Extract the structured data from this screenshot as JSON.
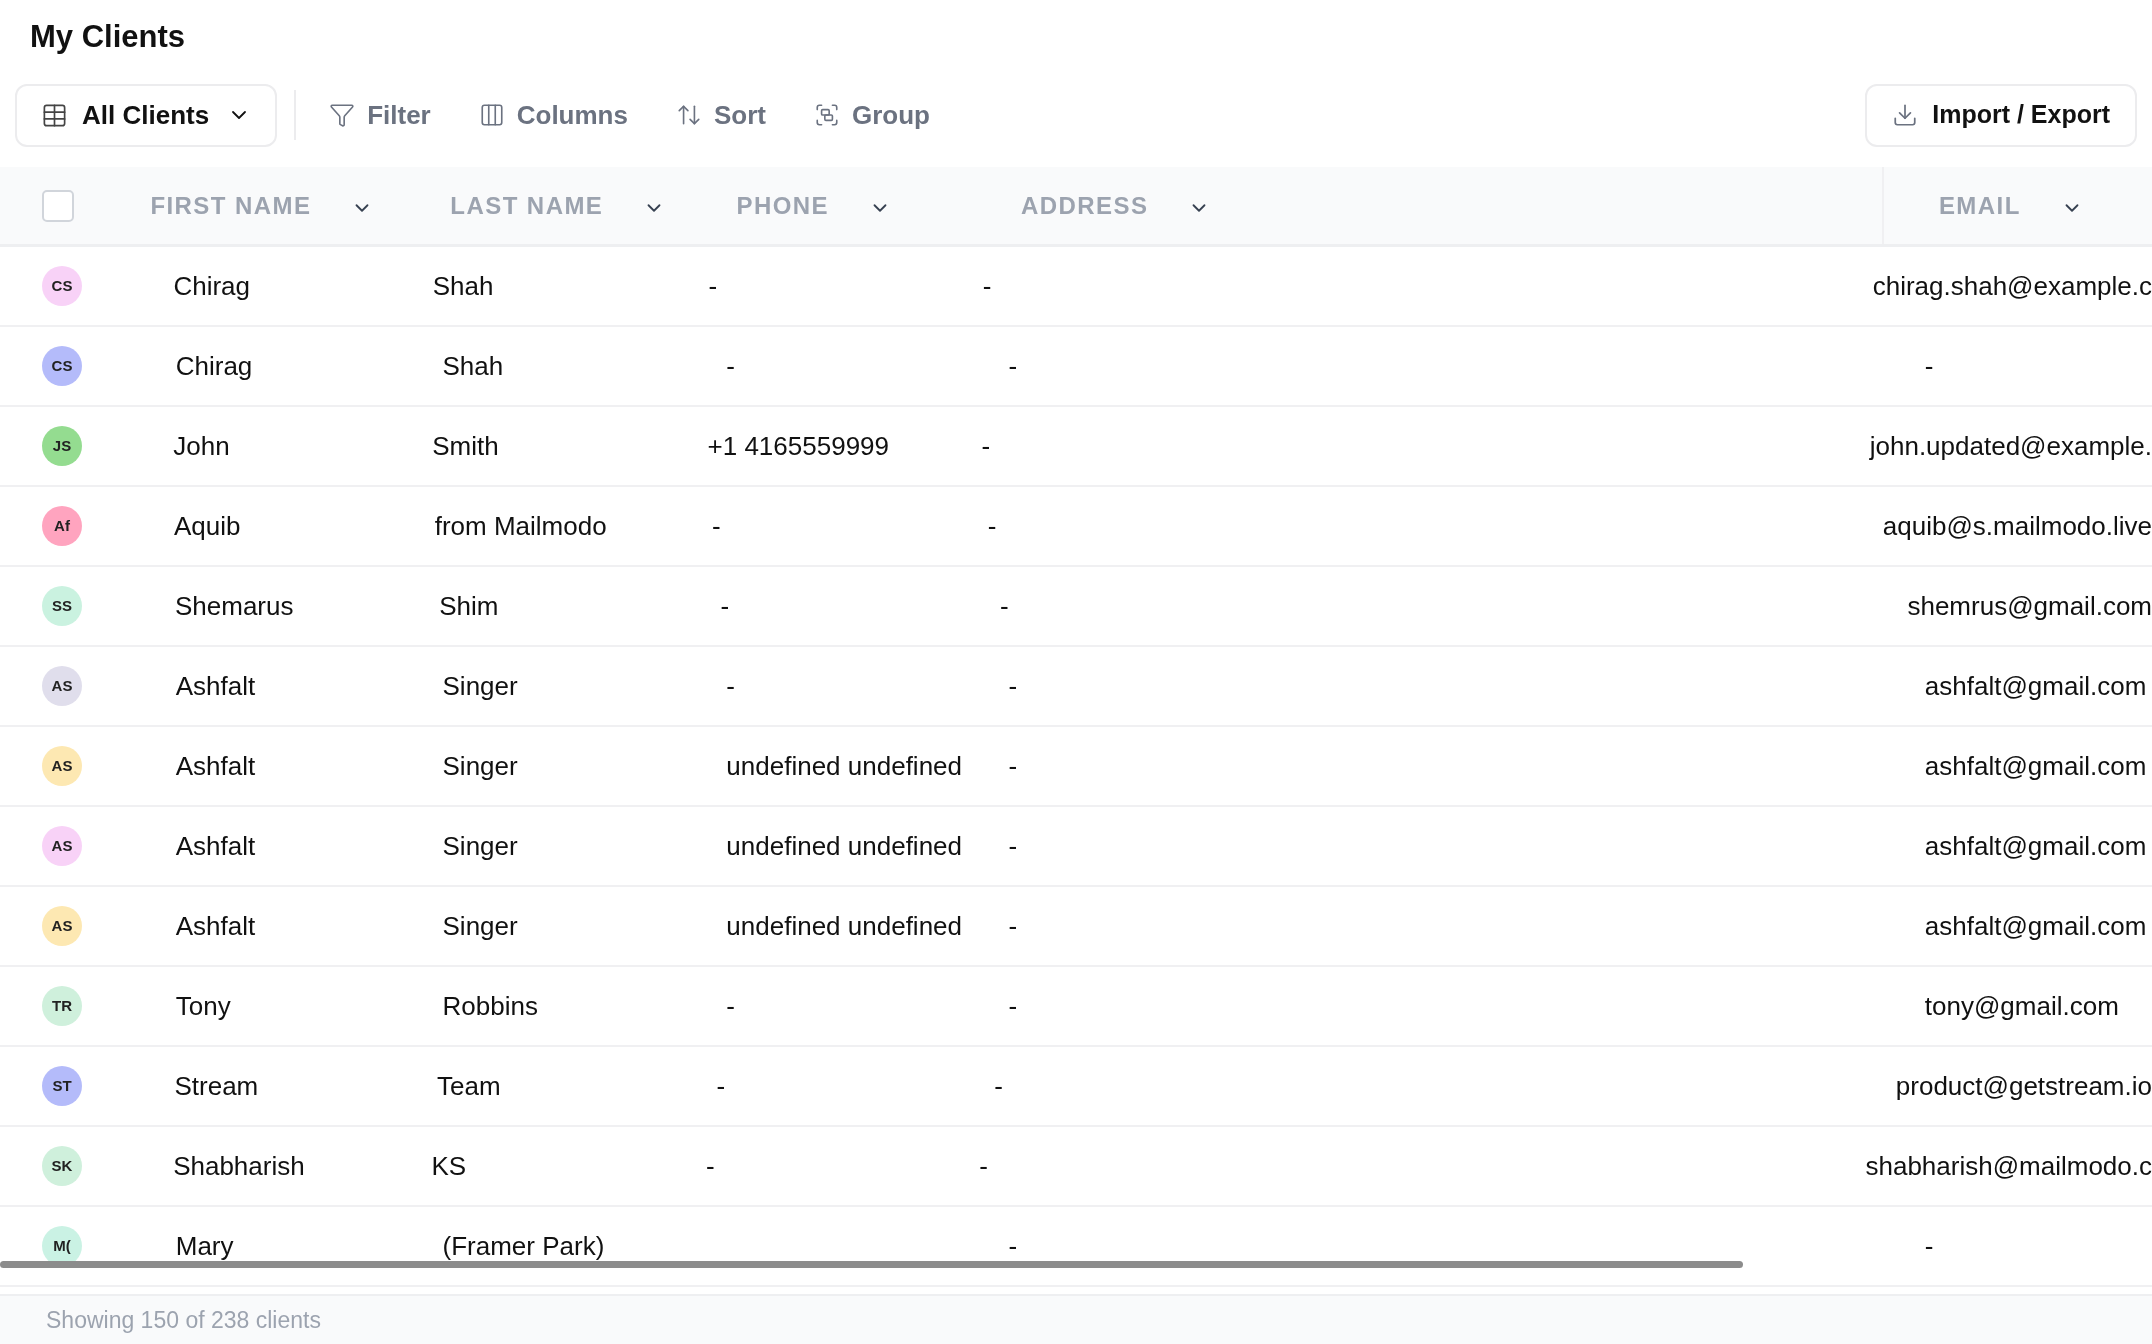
{
  "page_title": "My Clients",
  "toolbar": {
    "view": "All Clients",
    "actions": [
      {
        "kind": "filter",
        "label": "Filter"
      },
      {
        "kind": "columns",
        "label": "Columns"
      },
      {
        "kind": "sort",
        "label": "Sort"
      },
      {
        "kind": "group",
        "label": "Group"
      }
    ],
    "import_export": "Import / Export"
  },
  "table": {
    "select_all": {
      "checked": false
    },
    "columns": [
      "FIRST NAME",
      "LAST NAME",
      "PHONE",
      "ADDRESS",
      "EMAIL"
    ],
    "rows": [
      {
        "initials": "CS",
        "color": "#f8d2f7",
        "first_name": "Chirag",
        "last_name": "Shah",
        "phone": "-",
        "address": "-",
        "email": "chirag.shah@example.c"
      },
      {
        "initials": "CS",
        "color": "#b4bbfa",
        "first_name": "Chirag",
        "last_name": "Shah",
        "phone": "-",
        "address": "-",
        "email": "-"
      },
      {
        "initials": "JS",
        "color": "#94dc90",
        "first_name": "John",
        "last_name": "Smith",
        "phone": "+1 4165559999",
        "address": "-",
        "email": "john.updated@example."
      },
      {
        "initials": "Af",
        "color": "#ffa4bf",
        "first_name": "Aquib",
        "last_name": "from Mailmodo",
        "phone": "-",
        "address": "-",
        "email": "aquib@s.mailmodo.live"
      },
      {
        "initials": "SS",
        "color": "#caf2e0",
        "first_name": "Shemarus",
        "last_name": "Shim",
        "phone": "-",
        "address": "-",
        "email": "shemrus@gmail.com"
      },
      {
        "initials": "AS",
        "color": "#e0deec",
        "first_name": "Ashfalt",
        "last_name": "Singer",
        "phone": "-",
        "address": "-",
        "email": "ashfalt@gmail.com"
      },
      {
        "initials": "AS",
        "color": "#fde8b2",
        "first_name": "Ashfalt",
        "last_name": "Singer",
        "phone": "undefined undefined",
        "address": "-",
        "email": "ashfalt@gmail.com"
      },
      {
        "initials": "AS",
        "color": "#f8d2f7",
        "first_name": "Ashfalt",
        "last_name": "Singer",
        "phone": "undefined undefined",
        "address": "-",
        "email": "ashfalt@gmail.com"
      },
      {
        "initials": "AS",
        "color": "#fde8b2",
        "first_name": "Ashfalt",
        "last_name": "Singer",
        "phone": "undefined undefined",
        "address": "-",
        "email": "ashfalt@gmail.com"
      },
      {
        "initials": "TR",
        "color": "#cff0dc",
        "first_name": "Tony",
        "last_name": "Robbins",
        "phone": "-",
        "address": "-",
        "email": "tony@gmail.com"
      },
      {
        "initials": "ST",
        "color": "#b4bbfa",
        "first_name": "Stream",
        "last_name": "Team",
        "phone": "-",
        "address": "-",
        "email": "product@getstream.io"
      },
      {
        "initials": "SK",
        "color": "#cff0dc",
        "first_name": "Shabharish",
        "last_name": "KS",
        "phone": "-",
        "address": "-",
        "email": "shabharish@mailmodo.c"
      },
      {
        "initials": "M(",
        "color": "#caf2e4",
        "first_name": "Mary",
        "last_name": "(Framer Park)",
        "address": "-",
        "email": "-"
      }
    ]
  },
  "footer": "Showing 150 of 238 clients"
}
